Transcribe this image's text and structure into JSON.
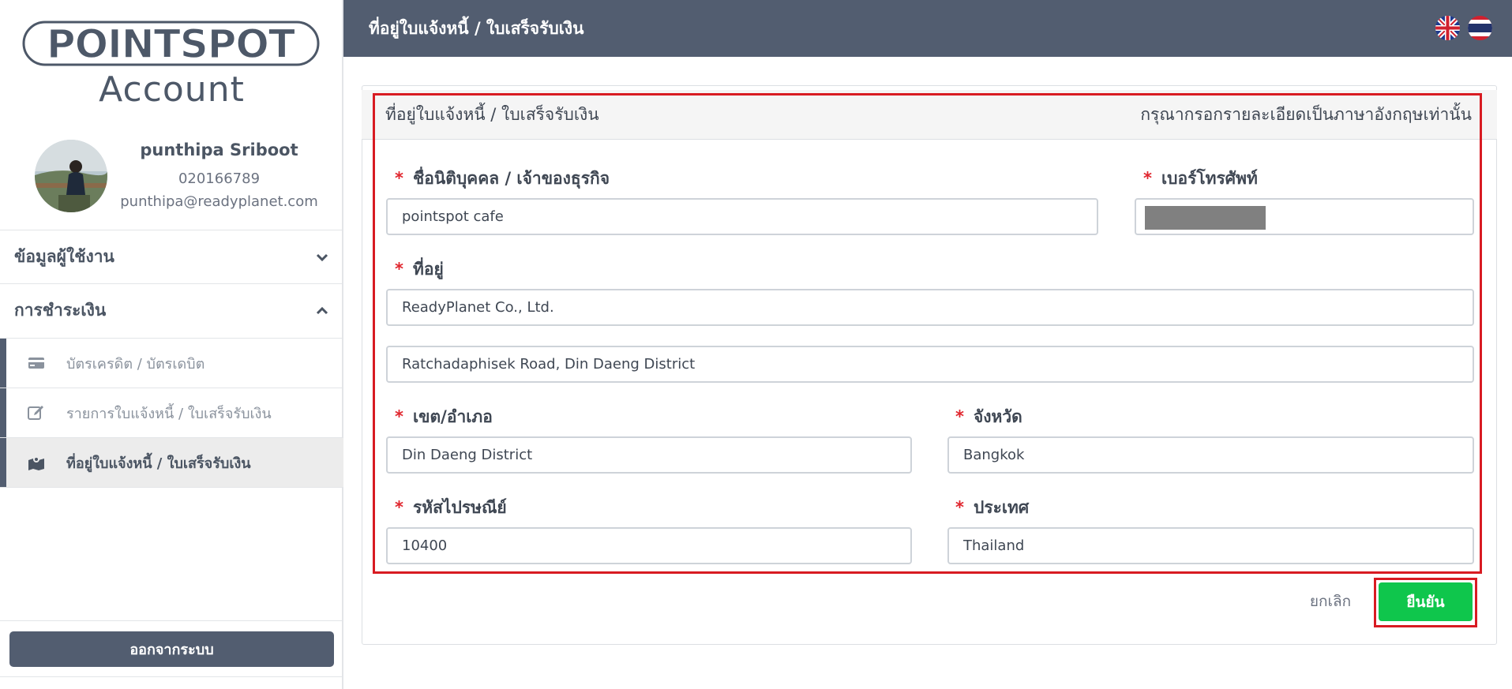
{
  "brand": {
    "logo_text": "POINTSPOT",
    "sub_title": "Account"
  },
  "profile": {
    "name": "punthipa Sriboot",
    "phone": "020166789",
    "email": "punthipa@readyplanet.com"
  },
  "sidebar": {
    "sections": [
      {
        "label": "ข้อมูลผู้ใช้งาน",
        "expanded": false
      },
      {
        "label": "การชำระเงิน",
        "expanded": true
      }
    ],
    "items": [
      {
        "label": "บัตรเครดิต / บัตรเดบิต",
        "icon": "credit-card-icon",
        "active": false
      },
      {
        "label": "รายการใบแจ้งหนี้ / ใบเสร็จรับเงิน",
        "icon": "edit-icon",
        "active": false
      },
      {
        "label": "ที่อยู่ใบแจ้งหนี้ / ใบเสร็จรับเงิน",
        "icon": "map-marker-icon",
        "active": true
      }
    ],
    "logout_label": "ออกจากระบบ"
  },
  "header": {
    "title": "ที่อยู่ใบแจ้งหนี้ / ใบเสร็จรับเงิน",
    "languages": [
      "en-flag-icon",
      "th-flag-icon"
    ]
  },
  "card": {
    "title": "ที่อยู่ใบแจ้งหนี้ / ใบเสร็จรับเงิน",
    "note": "กรุณากรอกรายละเอียดเป็นภาษาอังกฤษเท่านั้น"
  },
  "form": {
    "required_mark": "*",
    "company_label": "ชื่อนิติบุคคล / เจ้าของธุรกิจ",
    "company_value": "pointspot cafe",
    "phone_label": "เบอร์โทรศัพท์",
    "address_label": "ที่อยู่",
    "address1_value": "ReadyPlanet Co., Ltd.",
    "address2_value": "Ratchadaphisek Road, Din Daeng District",
    "district_label": "เขต/อำเภอ",
    "district_value": "Din Daeng District",
    "province_label": "จังหวัด",
    "province_value": "Bangkok",
    "postal_label": "รหัสไปรษณีย์",
    "postal_value": "10400",
    "country_label": "ประเทศ",
    "country_value": "Thailand"
  },
  "actions": {
    "cancel_label": "ยกเลิก",
    "confirm_label": "ยืนยัน"
  },
  "colors": {
    "header_bg": "#525d70",
    "confirm_green": "#0fc64c",
    "highlight_red": "#d81b22",
    "required_red": "#e0262e"
  }
}
